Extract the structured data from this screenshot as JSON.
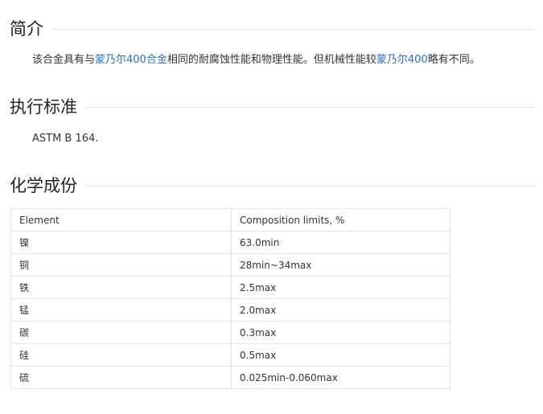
{
  "sections": {
    "intro": {
      "heading": "简介",
      "text_1": "该合金具有与",
      "link_1": "蒙乃尔400合金",
      "text_2": "相同的耐腐蚀性能和物理性能。但机械性能较",
      "link_2": "蒙乃尔400",
      "text_3": "略有不同。"
    },
    "standard": {
      "heading": "执行标准",
      "text": "ASTM B 164."
    },
    "composition": {
      "heading": "化学成份",
      "columns": [
        "Element",
        "Composition limits, %"
      ],
      "rows": [
        [
          "镍",
          "63.0min"
        ],
        [
          "铜",
          "28min~34max"
        ],
        [
          "铁",
          "2.5max"
        ],
        [
          "锰",
          "2.0max"
        ],
        [
          "碳",
          "0.3max"
        ],
        [
          "硅",
          "0.5max"
        ],
        [
          "硫",
          "0.025min-0.060max"
        ]
      ]
    }
  },
  "colors": {
    "link": "#2f6fb5",
    "rule": "#e4e4e4",
    "table_border": "#e2e2e2"
  }
}
